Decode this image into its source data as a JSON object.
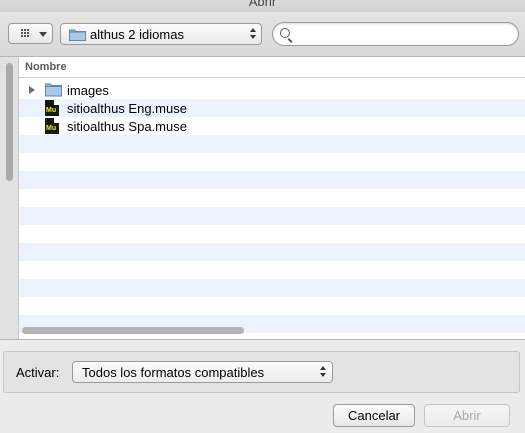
{
  "window": {
    "title": "Abrir"
  },
  "toolbar": {
    "view_button": {
      "icon": "grid-view-icon"
    },
    "location": {
      "folder_icon": "folder-icon",
      "label": "althus 2 idiomas"
    },
    "search": {
      "icon": "search-icon",
      "placeholder": "",
      "value": ""
    }
  },
  "file_list": {
    "column_header": "Nombre",
    "items": [
      {
        "name": "images",
        "type": "folder",
        "icon": "folder-icon",
        "expandable": true
      },
      {
        "name": "sitioalthus Eng.muse",
        "type": "file",
        "icon": "muse-file-icon",
        "expandable": false
      },
      {
        "name": "sitioalthus Spa.muse",
        "type": "file",
        "icon": "muse-file-icon",
        "expandable": false
      }
    ]
  },
  "options": {
    "enable_label": "Activar:",
    "format_value": "Todos los formatos compatibles"
  },
  "buttons": {
    "cancel": "Cancelar",
    "open": "Abrir"
  },
  "colors": {
    "row_stripe": "#edf3fe",
    "folder_blue": "#8fb6da",
    "muse_icon_bg": "#181818",
    "muse_icon_text": "#e6f227"
  }
}
